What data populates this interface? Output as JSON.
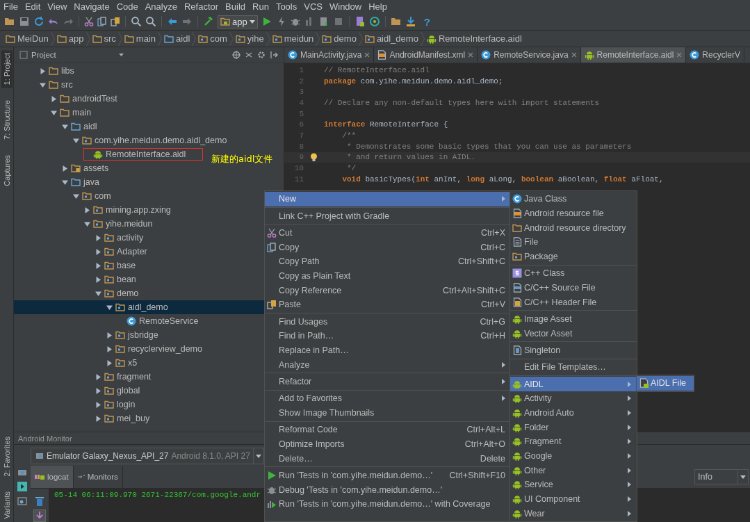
{
  "menubar": [
    "File",
    "Edit",
    "View",
    "Navigate",
    "Code",
    "Analyze",
    "Refactor",
    "Build",
    "Run",
    "Tools",
    "VCS",
    "Window",
    "Help"
  ],
  "toolbar": {
    "run_config": "app",
    "help": "?"
  },
  "breadcrumb": [
    "MeiDun",
    "app",
    "src",
    "main",
    "aidl",
    "com",
    "yihe",
    "meidun",
    "demo",
    "aidl_demo",
    "RemoteInterface.aidl"
  ],
  "tool_strip": {
    "top": [
      {
        "label": "1: Project",
        "selected": true
      },
      {
        "label": "7: Structure",
        "selected": false
      },
      {
        "label": "Captures",
        "selected": false
      }
    ],
    "bottom": [
      {
        "label": "2: Favorites",
        "selected": false
      },
      {
        "label": "Variants",
        "selected": false
      }
    ]
  },
  "project": {
    "title": "Project",
    "tree": [
      {
        "label": "libs",
        "kind": "folder",
        "expanded": false,
        "selected": false
      },
      {
        "label": "src",
        "kind": "folder",
        "expanded": true,
        "selected": false,
        "children": [
          {
            "label": "androidTest",
            "kind": "folder",
            "expanded": false,
            "selected": false
          },
          {
            "label": "main",
            "kind": "folder",
            "expanded": true,
            "selected": false,
            "children": [
              {
                "label": "aidl",
                "kind": "source-folder",
                "expanded": true,
                "selected": false,
                "children": [
                  {
                    "label": "com.yihe.meidun.demo.aidl_demo",
                    "kind": "package",
                    "expanded": true,
                    "selected": false,
                    "children": [
                      {
                        "label": "RemoteInterface.aidl",
                        "kind": "aidl-file",
                        "selected": false,
                        "highlighted": true
                      }
                    ]
                  }
                ]
              },
              {
                "label": "assets",
                "kind": "resource-folder",
                "expanded": false,
                "selected": false
              },
              {
                "label": "java",
                "kind": "source-folder",
                "expanded": true,
                "selected": false,
                "children": [
                  {
                    "label": "com",
                    "kind": "package",
                    "expanded": true,
                    "selected": false,
                    "children": [
                      {
                        "label": "mining.app.zxing",
                        "kind": "package",
                        "expanded": false,
                        "selected": false
                      },
                      {
                        "label": "yihe.meidun",
                        "kind": "package",
                        "expanded": true,
                        "selected": false,
                        "children": [
                          {
                            "label": "activity",
                            "kind": "package",
                            "expanded": false,
                            "selected": false
                          },
                          {
                            "label": "Adapter",
                            "kind": "package",
                            "expanded": false,
                            "selected": false
                          },
                          {
                            "label": "base",
                            "kind": "package",
                            "expanded": false,
                            "selected": false
                          },
                          {
                            "label": "bean",
                            "kind": "package",
                            "expanded": false,
                            "selected": false
                          },
                          {
                            "label": "demo",
                            "kind": "package",
                            "expanded": true,
                            "selected": false,
                            "children": [
                              {
                                "label": "aidl_demo",
                                "kind": "package",
                                "expanded": true,
                                "selected": true,
                                "children": [
                                  {
                                    "label": "RemoteService",
                                    "kind": "class",
                                    "selected": false
                                  }
                                ]
                              },
                              {
                                "label": "jsbridge",
                                "kind": "package",
                                "expanded": false,
                                "selected": false
                              },
                              {
                                "label": "recyclerview_demo",
                                "kind": "package",
                                "expanded": false,
                                "selected": false
                              },
                              {
                                "label": "x5",
                                "kind": "package",
                                "expanded": false,
                                "selected": false
                              }
                            ]
                          },
                          {
                            "label": "fragment",
                            "kind": "package",
                            "expanded": false,
                            "selected": false
                          },
                          {
                            "label": "global",
                            "kind": "package",
                            "expanded": false,
                            "selected": false
                          },
                          {
                            "label": "login",
                            "kind": "package",
                            "expanded": false,
                            "selected": false
                          },
                          {
                            "label": "mei_buy",
                            "kind": "package",
                            "expanded": false,
                            "selected": false
                          }
                        ]
                      }
                    ]
                  }
                ]
              }
            ]
          }
        ]
      }
    ]
  },
  "annotation": "新建的aidl文件",
  "editor": {
    "tabs": [
      {
        "label": "MainActivity.java",
        "kind": "class",
        "selected": false
      },
      {
        "label": "AndroidManifest.xml",
        "kind": "manifest",
        "selected": false
      },
      {
        "label": "RemoteService.java",
        "kind": "class",
        "selected": false
      },
      {
        "label": "RemoteInterface.aidl",
        "kind": "aidl-file",
        "selected": true
      },
      {
        "label": "RecyclerV",
        "kind": "class",
        "selected": false
      }
    ],
    "lines": [
      {
        "number": "1",
        "current": false,
        "segments": [
          {
            "kind": "comment",
            "text": "// RemoteInterface.aidl"
          }
        ]
      },
      {
        "number": "2",
        "current": false,
        "segments": [
          {
            "kind": "keyword",
            "text": "package"
          },
          {
            "kind": "plain",
            "text": " com.yihe.meidun.demo.aidl_demo;"
          }
        ]
      },
      {
        "number": "3",
        "current": false
      },
      {
        "number": "4",
        "current": false,
        "segments": [
          {
            "kind": "comment",
            "text": "// Declare any non-default types here with import statements"
          }
        ]
      },
      {
        "number": "5",
        "current": false
      },
      {
        "number": "6",
        "current": false,
        "segments": [
          {
            "kind": "keyword",
            "text": "interface"
          },
          {
            "kind": "plain",
            "text": " RemoteInterface {"
          }
        ]
      },
      {
        "number": "7",
        "current": false,
        "segments": [
          {
            "kind": "comment",
            "text": "    /**"
          }
        ]
      },
      {
        "number": "8",
        "current": false,
        "segments": [
          {
            "kind": "comment",
            "text": "     * Demonstrates some basic types that you can use as parameters"
          }
        ]
      },
      {
        "number": "9",
        "current": true,
        "segments": [
          {
            "kind": "comment",
            "text": "     * and return values in AIDL."
          }
        ]
      },
      {
        "number": "10",
        "current": false,
        "segments": [
          {
            "kind": "comment",
            "text": "     */"
          }
        ]
      },
      {
        "number": "11",
        "current": false,
        "segments": [
          {
            "kind": "keyword",
            "text": "    void"
          },
          {
            "kind": "plain",
            "text": " basicTypes("
          },
          {
            "kind": "keyword",
            "text": "int"
          },
          {
            "kind": "plain",
            "text": " anInt, "
          },
          {
            "kind": "keyword",
            "text": "long"
          },
          {
            "kind": "plain",
            "text": " aLong, "
          },
          {
            "kind": "keyword",
            "text": "boolean"
          },
          {
            "kind": "plain",
            "text": " aBoolean, "
          },
          {
            "kind": "keyword",
            "text": "float"
          },
          {
            "kind": "plain",
            "text": " aFloat,"
          }
        ]
      }
    ]
  },
  "monitor": {
    "title": "Android Monitor",
    "device": {
      "name": "Emulator Galaxy_Nexus_API_27",
      "detail": "Android 8.1.0, API 27"
    },
    "tabs": [
      {
        "label": "logcat",
        "selected": true
      },
      {
        "label": "Monitors",
        "selected": false
      }
    ],
    "log_level": "Info",
    "log_lines": [
      "05-14 06:11:09.970 2671-22367/com.google.andr"
    ]
  },
  "context_menu": {
    "groups": [
      {
        "items": [
          {
            "label": "New",
            "kind": "plain",
            "submenu": true,
            "selected": true
          }
        ]
      },
      {
        "items": [
          {
            "label": "Link C++ Project with Gradle",
            "kind": "plain",
            "submenu": false,
            "selected": false
          }
        ]
      },
      {
        "items": [
          {
            "label": "Cut",
            "shortcut": "Ctrl+X",
            "kind": "cut",
            "submenu": false,
            "selected": false
          },
          {
            "label": "Copy",
            "shortcut": "Ctrl+C",
            "kind": "copy",
            "submenu": false,
            "selected": false
          },
          {
            "label": "Copy Path",
            "shortcut": "Ctrl+Shift+C",
            "kind": "plain",
            "submenu": false,
            "selected": false
          },
          {
            "label": "Copy as Plain Text",
            "kind": "plain",
            "submenu": false,
            "selected": false
          },
          {
            "label": "Copy Reference",
            "shortcut": "Ctrl+Alt+Shift+C",
            "kind": "plain",
            "submenu": false,
            "selected": false
          },
          {
            "label": "Paste",
            "shortcut": "Ctrl+V",
            "kind": "paste",
            "submenu": false,
            "selected": false
          }
        ]
      },
      {
        "items": [
          {
            "label": "Find Usages",
            "shortcut": "Ctrl+G",
            "kind": "plain",
            "submenu": false,
            "selected": false
          },
          {
            "label": "Find in Path…",
            "shortcut": "Ctrl+H",
            "kind": "plain",
            "submenu": false,
            "selected": false
          },
          {
            "label": "Replace in Path…",
            "kind": "plain",
            "submenu": false,
            "selected": false
          },
          {
            "label": "Analyze",
            "kind": "plain",
            "submenu": true,
            "selected": false
          }
        ]
      },
      {
        "items": [
          {
            "label": "Refactor",
            "kind": "plain",
            "submenu": true,
            "selected": false
          }
        ]
      },
      {
        "items": [
          {
            "label": "Add to Favorites",
            "kind": "plain",
            "submenu": true,
            "selected": false
          },
          {
            "label": "Show Image Thumbnails",
            "kind": "plain",
            "submenu": false,
            "selected": false
          }
        ]
      },
      {
        "items": [
          {
            "label": "Reformat Code",
            "shortcut": "Ctrl+Alt+L",
            "kind": "plain",
            "submenu": false,
            "selected": false
          },
          {
            "label": "Optimize Imports",
            "shortcut": "Ctrl+Alt+O",
            "kind": "plain",
            "submenu": false,
            "selected": false
          },
          {
            "label": "Delete…",
            "shortcut": "Delete",
            "kind": "plain",
            "submenu": false,
            "selected": false
          }
        ]
      },
      {
        "items": [
          {
            "label": "Run 'Tests in 'com.yihe.meidun.demo…'",
            "shortcut": "Ctrl+Shift+F10",
            "kind": "run",
            "submenu": false,
            "selected": false
          },
          {
            "label": "Debug 'Tests in 'com.yihe.meidun.demo…'",
            "kind": "debug",
            "submenu": false,
            "selected": false
          },
          {
            "label": "Run 'Tests in 'com.yihe.meidun.demo…' with Coverage",
            "kind": "coverage",
            "submenu": false,
            "selected": false
          }
        ]
      }
    ]
  },
  "new_submenu": {
    "groups": [
      {
        "items": [
          {
            "label": "Java Class",
            "kind": "class",
            "submenu": false,
            "selected": false
          },
          {
            "label": "Android resource file",
            "kind": "resource-file",
            "submenu": false,
            "selected": false
          },
          {
            "label": "Android resource directory",
            "kind": "folder",
            "submenu": false,
            "selected": false
          },
          {
            "label": "File",
            "kind": "file",
            "submenu": false,
            "selected": false
          },
          {
            "label": "Package",
            "kind": "package",
            "submenu": false,
            "selected": false
          }
        ]
      },
      {
        "items": [
          {
            "label": "C++ Class",
            "kind": "cpp-class",
            "submenu": false,
            "selected": false
          },
          {
            "label": "C/C++ Source File",
            "kind": "cpp-source",
            "submenu": false,
            "selected": false
          },
          {
            "label": "C/C++ Header File",
            "kind": "cpp-header",
            "submenu": false,
            "selected": false
          }
        ]
      },
      {
        "items": [
          {
            "label": "Image Asset",
            "kind": "android",
            "submenu": false,
            "selected": false
          },
          {
            "label": "Vector Asset",
            "kind": "android",
            "submenu": false,
            "selected": false
          }
        ]
      },
      {
        "items": [
          {
            "label": "Singleton",
            "kind": "singleton",
            "submenu": false,
            "selected": false
          }
        ]
      },
      {
        "items": [
          {
            "label": "Edit File Templates…",
            "kind": "plain",
            "submenu": false,
            "selected": false
          }
        ]
      },
      {
        "items": [
          {
            "label": "AIDL",
            "kind": "android",
            "submenu": true,
            "selected": true
          },
          {
            "label": "Activity",
            "kind": "android",
            "submenu": true,
            "selected": false
          },
          {
            "label": "Android Auto",
            "kind": "android",
            "submenu": true,
            "selected": false
          },
          {
            "label": "Folder",
            "kind": "android",
            "submenu": true,
            "selected": false
          },
          {
            "label": "Fragment",
            "kind": "android",
            "submenu": true,
            "selected": false
          },
          {
            "label": "Google",
            "kind": "android",
            "submenu": true,
            "selected": false
          },
          {
            "label": "Other",
            "kind": "android",
            "submenu": true,
            "selected": false
          },
          {
            "label": "Service",
            "kind": "android",
            "submenu": true,
            "selected": false
          },
          {
            "label": "UI Component",
            "kind": "android",
            "submenu": true,
            "selected": false
          },
          {
            "label": "Wear",
            "kind": "android",
            "submenu": true,
            "selected": false
          }
        ]
      }
    ]
  },
  "aidl_submenu": {
    "groups": [
      {
        "items": [
          {
            "label": "AIDL File",
            "kind": "new-file",
            "submenu": false,
            "selected": true
          }
        ]
      }
    ]
  }
}
